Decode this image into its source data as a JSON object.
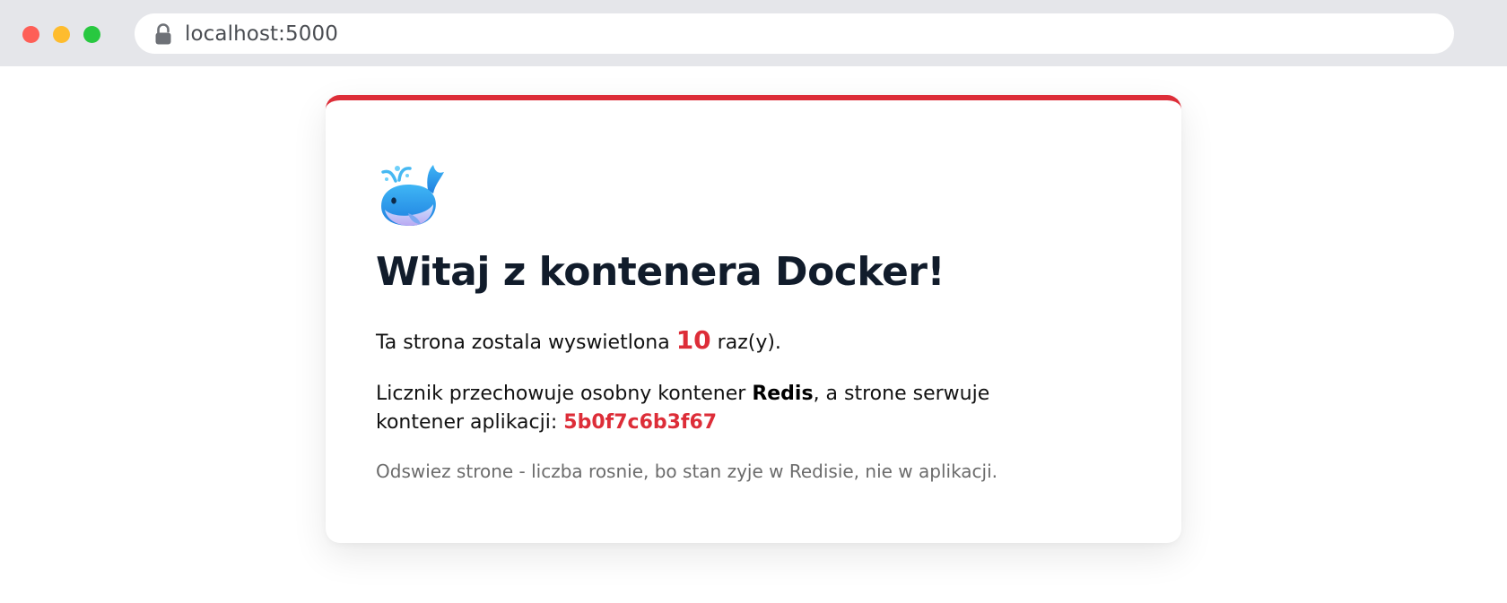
{
  "browser": {
    "url": "localhost:5000",
    "lock_icon": "lock-icon"
  },
  "card": {
    "accent_color": "#dd2d38",
    "icon": "whale-icon",
    "title": "Witaj z kontenera Docker!",
    "count_prefix": "Ta strona zostala wyswietlona ",
    "count_value": "10",
    "count_suffix": " raz(y).",
    "redis_prefix": "Licznik przechowuje osobny kontener ",
    "redis_bold": "Redis",
    "redis_middle": ", a strone serwuje kontener aplikacji: ",
    "container_id": "5b0f7c6b3f67",
    "note": "Odswiez strone - liczba rosnie, bo stan zyje w Redisie, nie w aplikacji."
  }
}
